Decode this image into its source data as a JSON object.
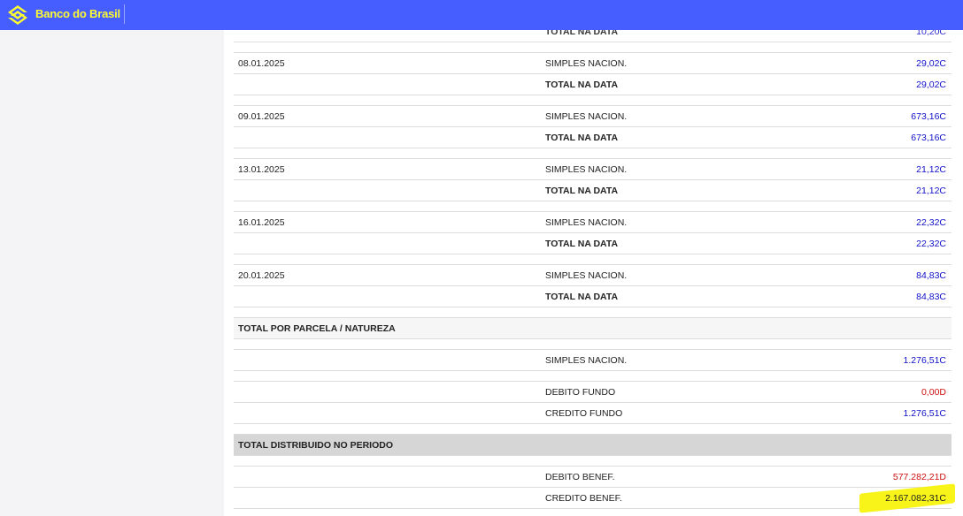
{
  "header": {
    "brand": "Banco do Brasil",
    "brand_color": "#fcfc30",
    "bar_color": "#465eff",
    "logo_icon": "banco-do-brasil-logo-icon"
  },
  "statement": {
    "rows": [
      {
        "kind": "data",
        "date": "",
        "desc": "TOTAL NA DATA",
        "desc_bold": true,
        "value": "10,20C",
        "color": "blue"
      },
      {
        "kind": "gap"
      },
      {
        "kind": "data",
        "date": "08.01.2025",
        "desc": "SIMPLES NACION.",
        "desc_bold": false,
        "value": "29,02C",
        "color": "blue"
      },
      {
        "kind": "data",
        "date": "",
        "desc": "TOTAL NA DATA",
        "desc_bold": true,
        "value": "29,02C",
        "color": "blue"
      },
      {
        "kind": "gap"
      },
      {
        "kind": "data",
        "date": "09.01.2025",
        "desc": "SIMPLES NACION.",
        "desc_bold": false,
        "value": "673,16C",
        "color": "blue"
      },
      {
        "kind": "data",
        "date": "",
        "desc": "TOTAL NA DATA",
        "desc_bold": true,
        "value": "673,16C",
        "color": "blue"
      },
      {
        "kind": "gap"
      },
      {
        "kind": "data",
        "date": "13.01.2025",
        "desc": "SIMPLES NACION.",
        "desc_bold": false,
        "value": "21,12C",
        "color": "blue"
      },
      {
        "kind": "data",
        "date": "",
        "desc": "TOTAL NA DATA",
        "desc_bold": true,
        "value": "21,12C",
        "color": "blue"
      },
      {
        "kind": "gap"
      },
      {
        "kind": "data",
        "date": "16.01.2025",
        "desc": "SIMPLES NACION.",
        "desc_bold": false,
        "value": "22,32C",
        "color": "blue"
      },
      {
        "kind": "data",
        "date": "",
        "desc": "TOTAL NA DATA",
        "desc_bold": true,
        "value": "22,32C",
        "color": "blue"
      },
      {
        "kind": "gap"
      },
      {
        "kind": "data",
        "date": "20.01.2025",
        "desc": "SIMPLES NACION.",
        "desc_bold": false,
        "value": "84,83C",
        "color": "blue"
      },
      {
        "kind": "data",
        "date": "",
        "desc": "TOTAL NA DATA",
        "desc_bold": true,
        "value": "84,83C",
        "color": "blue"
      },
      {
        "kind": "gap"
      },
      {
        "kind": "section",
        "date": "TOTAL POR PARCELA / NATUREZA"
      },
      {
        "kind": "gap"
      },
      {
        "kind": "data",
        "date": "",
        "desc": "SIMPLES NACION.",
        "desc_bold": false,
        "value": "1.276,51C",
        "color": "blue"
      },
      {
        "kind": "gap"
      },
      {
        "kind": "data",
        "date": "",
        "desc": "DEBITO FUNDO",
        "desc_bold": false,
        "value": "0,00D",
        "color": "red"
      },
      {
        "kind": "data",
        "date": "",
        "desc": "CREDITO FUNDO",
        "desc_bold": false,
        "value": "1.276,51C",
        "color": "blue"
      },
      {
        "kind": "gap"
      },
      {
        "kind": "section-dark",
        "date": "TOTAL DISTRIBUIDO NO PERIODO"
      },
      {
        "kind": "gap"
      },
      {
        "kind": "data",
        "date": "",
        "desc": "DEBITO BENEF.",
        "desc_bold": false,
        "value": "577.282,21D",
        "color": "red"
      },
      {
        "kind": "data",
        "date": "",
        "desc": "CREDITO BENEF.",
        "desc_bold": false,
        "value": "2.167.082,31C",
        "color": "dark",
        "highlighted": true
      }
    ]
  }
}
